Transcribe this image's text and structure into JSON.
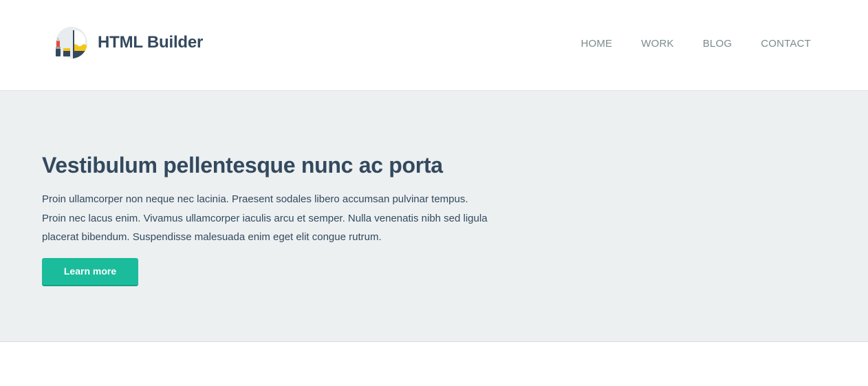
{
  "brand": {
    "name": "HTML Builder",
    "logo_icon": "paintbrush-icon"
  },
  "nav": {
    "items": [
      {
        "label": "HOME"
      },
      {
        "label": "WORK"
      },
      {
        "label": "BLOG"
      },
      {
        "label": "CONTACT"
      }
    ]
  },
  "hero": {
    "title": "Vestibulum pellentesque nunc ac porta",
    "text": "Proin ullamcorper non neque nec lacinia. Praesent sodales libero accumsan pulvinar tempus. Proin nec lacus enim. Vivamus ullamcorper iaculis arcu et semper. Nulla venenatis nibh sed ligula placerat bibendum. Suspendisse malesuada enim eget elit congue rutrum.",
    "button_label": "Learn more"
  },
  "colors": {
    "primary_text": "#34495e",
    "nav_text": "#7b8a8b",
    "accent": "#1abc9c",
    "hero_background": "#ecf0f1"
  }
}
